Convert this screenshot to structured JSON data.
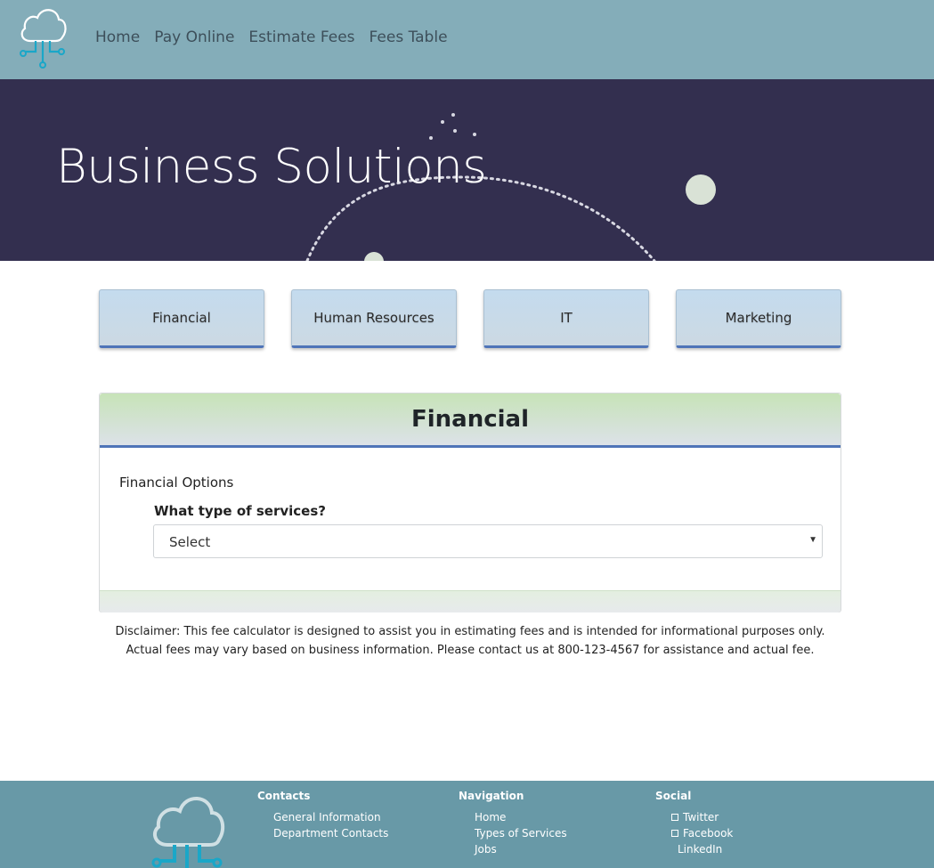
{
  "nav": {
    "logo_icon": "cloud-circuit-icon",
    "links": [
      "Home",
      "Pay Online",
      "Estimate Fees",
      "Fees Table"
    ]
  },
  "hero": {
    "title": "Business Solutions"
  },
  "categories": [
    "Financial",
    "Human Resources",
    "IT",
    "Marketing"
  ],
  "panel": {
    "title": "Financial",
    "options_label": "Financial Options",
    "question": "What type of services?",
    "select_value": "Select"
  },
  "disclaimer": {
    "line1": "Disclaimer: This fee calculator is designed to assist you in estimating fees and is intended for informational purposes only.",
    "line2": "Actual fees may vary based on business information. Please contact us at 800-123-4567 for assistance and actual fee."
  },
  "footer": {
    "contacts": {
      "heading": "Contacts",
      "items": [
        "General Information",
        "Department Contacts"
      ]
    },
    "navigation": {
      "heading": "Navigation",
      "items": [
        "Home",
        "Types of Services",
        "Jobs"
      ]
    },
    "social": {
      "heading": "Social",
      "items": [
        "Twitter",
        "Facebook",
        "LinkedIn"
      ]
    }
  },
  "colors": {
    "topbar": "#84adb9",
    "hero": "#332f4f",
    "footer": "#6899a7",
    "accent": "#4f74b8"
  }
}
